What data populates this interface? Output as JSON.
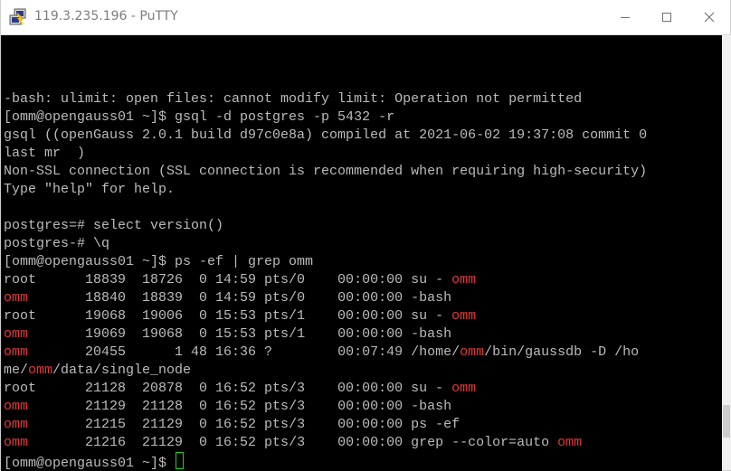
{
  "window": {
    "title": "119.3.235.196 - PuTTY",
    "app_icon": "putty-icon",
    "controls": {
      "minimize": "minimize-icon",
      "maximize": "maximize-icon",
      "close": "close-icon"
    }
  },
  "colors": {
    "terminal_bg": "#000000",
    "terminal_fg": "#bbbbbb",
    "highlight": "#e53636",
    "cursor": "#19d119"
  },
  "scrollbar": {
    "position_fraction": 0.92
  },
  "terminal": {
    "lines": [
      {
        "segs": [
          {
            "t": ""
          }
        ]
      },
      {
        "segs": [
          {
            "t": ""
          }
        ]
      },
      {
        "segs": [
          {
            "t": ""
          }
        ]
      },
      {
        "segs": [
          {
            "t": "-bash: ulimit: open files: cannot modify limit: Operation not permitted"
          }
        ]
      },
      {
        "segs": [
          {
            "t": "[omm@opengauss01 ~]$ gsql -d postgres -p 5432 -r"
          }
        ]
      },
      {
        "segs": [
          {
            "t": "gsql ((openGauss 2.0.1 build d97c0e8a) compiled at 2021-06-02 19:37:08 commit 0"
          }
        ]
      },
      {
        "segs": [
          {
            "t": "last mr  )"
          }
        ]
      },
      {
        "segs": [
          {
            "t": "Non-SSL connection (SSL connection is recommended when requiring high-security)"
          }
        ]
      },
      {
        "segs": [
          {
            "t": "Type \"help\" for help."
          }
        ]
      },
      {
        "segs": [
          {
            "t": ""
          }
        ]
      },
      {
        "segs": [
          {
            "t": "postgres=# select version()"
          }
        ]
      },
      {
        "segs": [
          {
            "t": "postgres-# \\q"
          }
        ]
      },
      {
        "segs": [
          {
            "t": "[omm@opengauss01 ~]$ ps -ef | grep omm"
          }
        ]
      },
      {
        "segs": [
          {
            "t": "root      18839  18726  0 14:59 pts/0    00:00:00 su - "
          },
          {
            "t": "omm",
            "c": "red"
          }
        ]
      },
      {
        "segs": [
          {
            "t": "omm",
            "c": "red"
          },
          {
            "t": "       18840  18839  0 14:59 pts/0    00:00:00 -bash"
          }
        ]
      },
      {
        "segs": [
          {
            "t": "root      19068  19006  0 15:53 pts/1    00:00:00 su - "
          },
          {
            "t": "omm",
            "c": "red"
          }
        ]
      },
      {
        "segs": [
          {
            "t": "omm",
            "c": "red"
          },
          {
            "t": "       19069  19068  0 15:53 pts/1    00:00:00 -bash"
          }
        ]
      },
      {
        "segs": [
          {
            "t": "omm",
            "c": "red"
          },
          {
            "t": "       20455      1 48 16:36 ?        00:07:49 /home/"
          },
          {
            "t": "omm",
            "c": "red"
          },
          {
            "t": "/bin/gaussdb -D /ho"
          }
        ]
      },
      {
        "segs": [
          {
            "t": "me/"
          },
          {
            "t": "omm",
            "c": "red"
          },
          {
            "t": "/data/single_node"
          }
        ]
      },
      {
        "segs": [
          {
            "t": "root      21128  20878  0 16:52 pts/3    00:00:00 su - "
          },
          {
            "t": "omm",
            "c": "red"
          }
        ]
      },
      {
        "segs": [
          {
            "t": "omm",
            "c": "red"
          },
          {
            "t": "       21129  21128  0 16:52 pts/3    00:00:00 -bash"
          }
        ]
      },
      {
        "segs": [
          {
            "t": "omm",
            "c": "red"
          },
          {
            "t": "       21215  21129  0 16:52 pts/3    00:00:00 ps -ef"
          }
        ]
      },
      {
        "segs": [
          {
            "t": "omm",
            "c": "red"
          },
          {
            "t": "       21216  21129  0 16:52 pts/3    00:00:00 grep --color=auto "
          },
          {
            "t": "omm",
            "c": "red"
          }
        ]
      },
      {
        "segs": [
          {
            "t": "[omm@opengauss01 ~]$ "
          }
        ],
        "cursor": true
      }
    ]
  }
}
